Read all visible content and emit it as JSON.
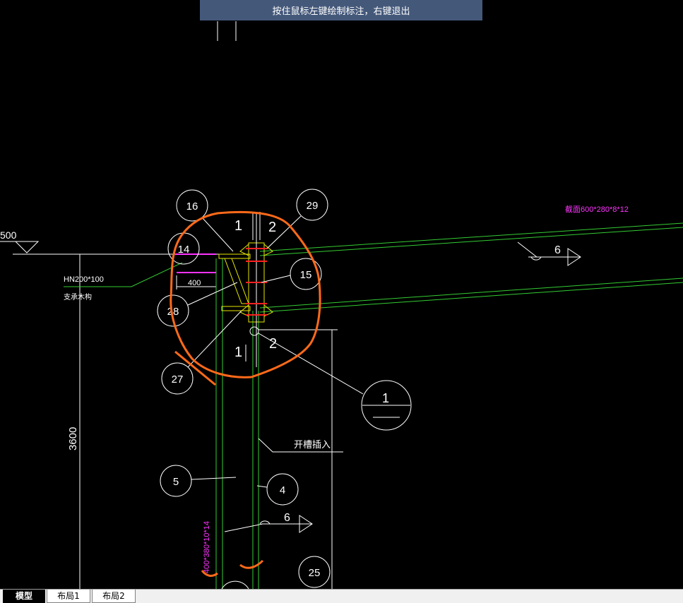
{
  "status_hint": "按住鼠标左键绘制标注，右键退出",
  "drawing": {
    "balloons": [
      "16",
      "29",
      "14",
      "15",
      "28",
      "27",
      "5",
      "4",
      "25"
    ],
    "section_marker": "1",
    "elevation_label": "500",
    "beam_label": "HN200*100",
    "beam_note": "支承木构",
    "length_label": "400",
    "height_label": "3600",
    "slot_label": "开槽插入",
    "section_size_top": "截面600*280*8*12",
    "section_size_column": "400*380*10*14",
    "weld_mark_1": "6",
    "weld_mark_2": "6",
    "section_cut_1": "1",
    "section_cut_2": "2",
    "section_cut_3": "1",
    "section_cut_4": "2",
    "colors": {
      "background": "#000000",
      "line": "#ffffff",
      "beam": "#33cc33",
      "magenta": "#ff33ff",
      "highlight": "#ff6a1a",
      "yellow": "#e6e600",
      "red": "#ff2020"
    }
  },
  "tabs": [
    "模型",
    "布局1",
    "布局2"
  ]
}
